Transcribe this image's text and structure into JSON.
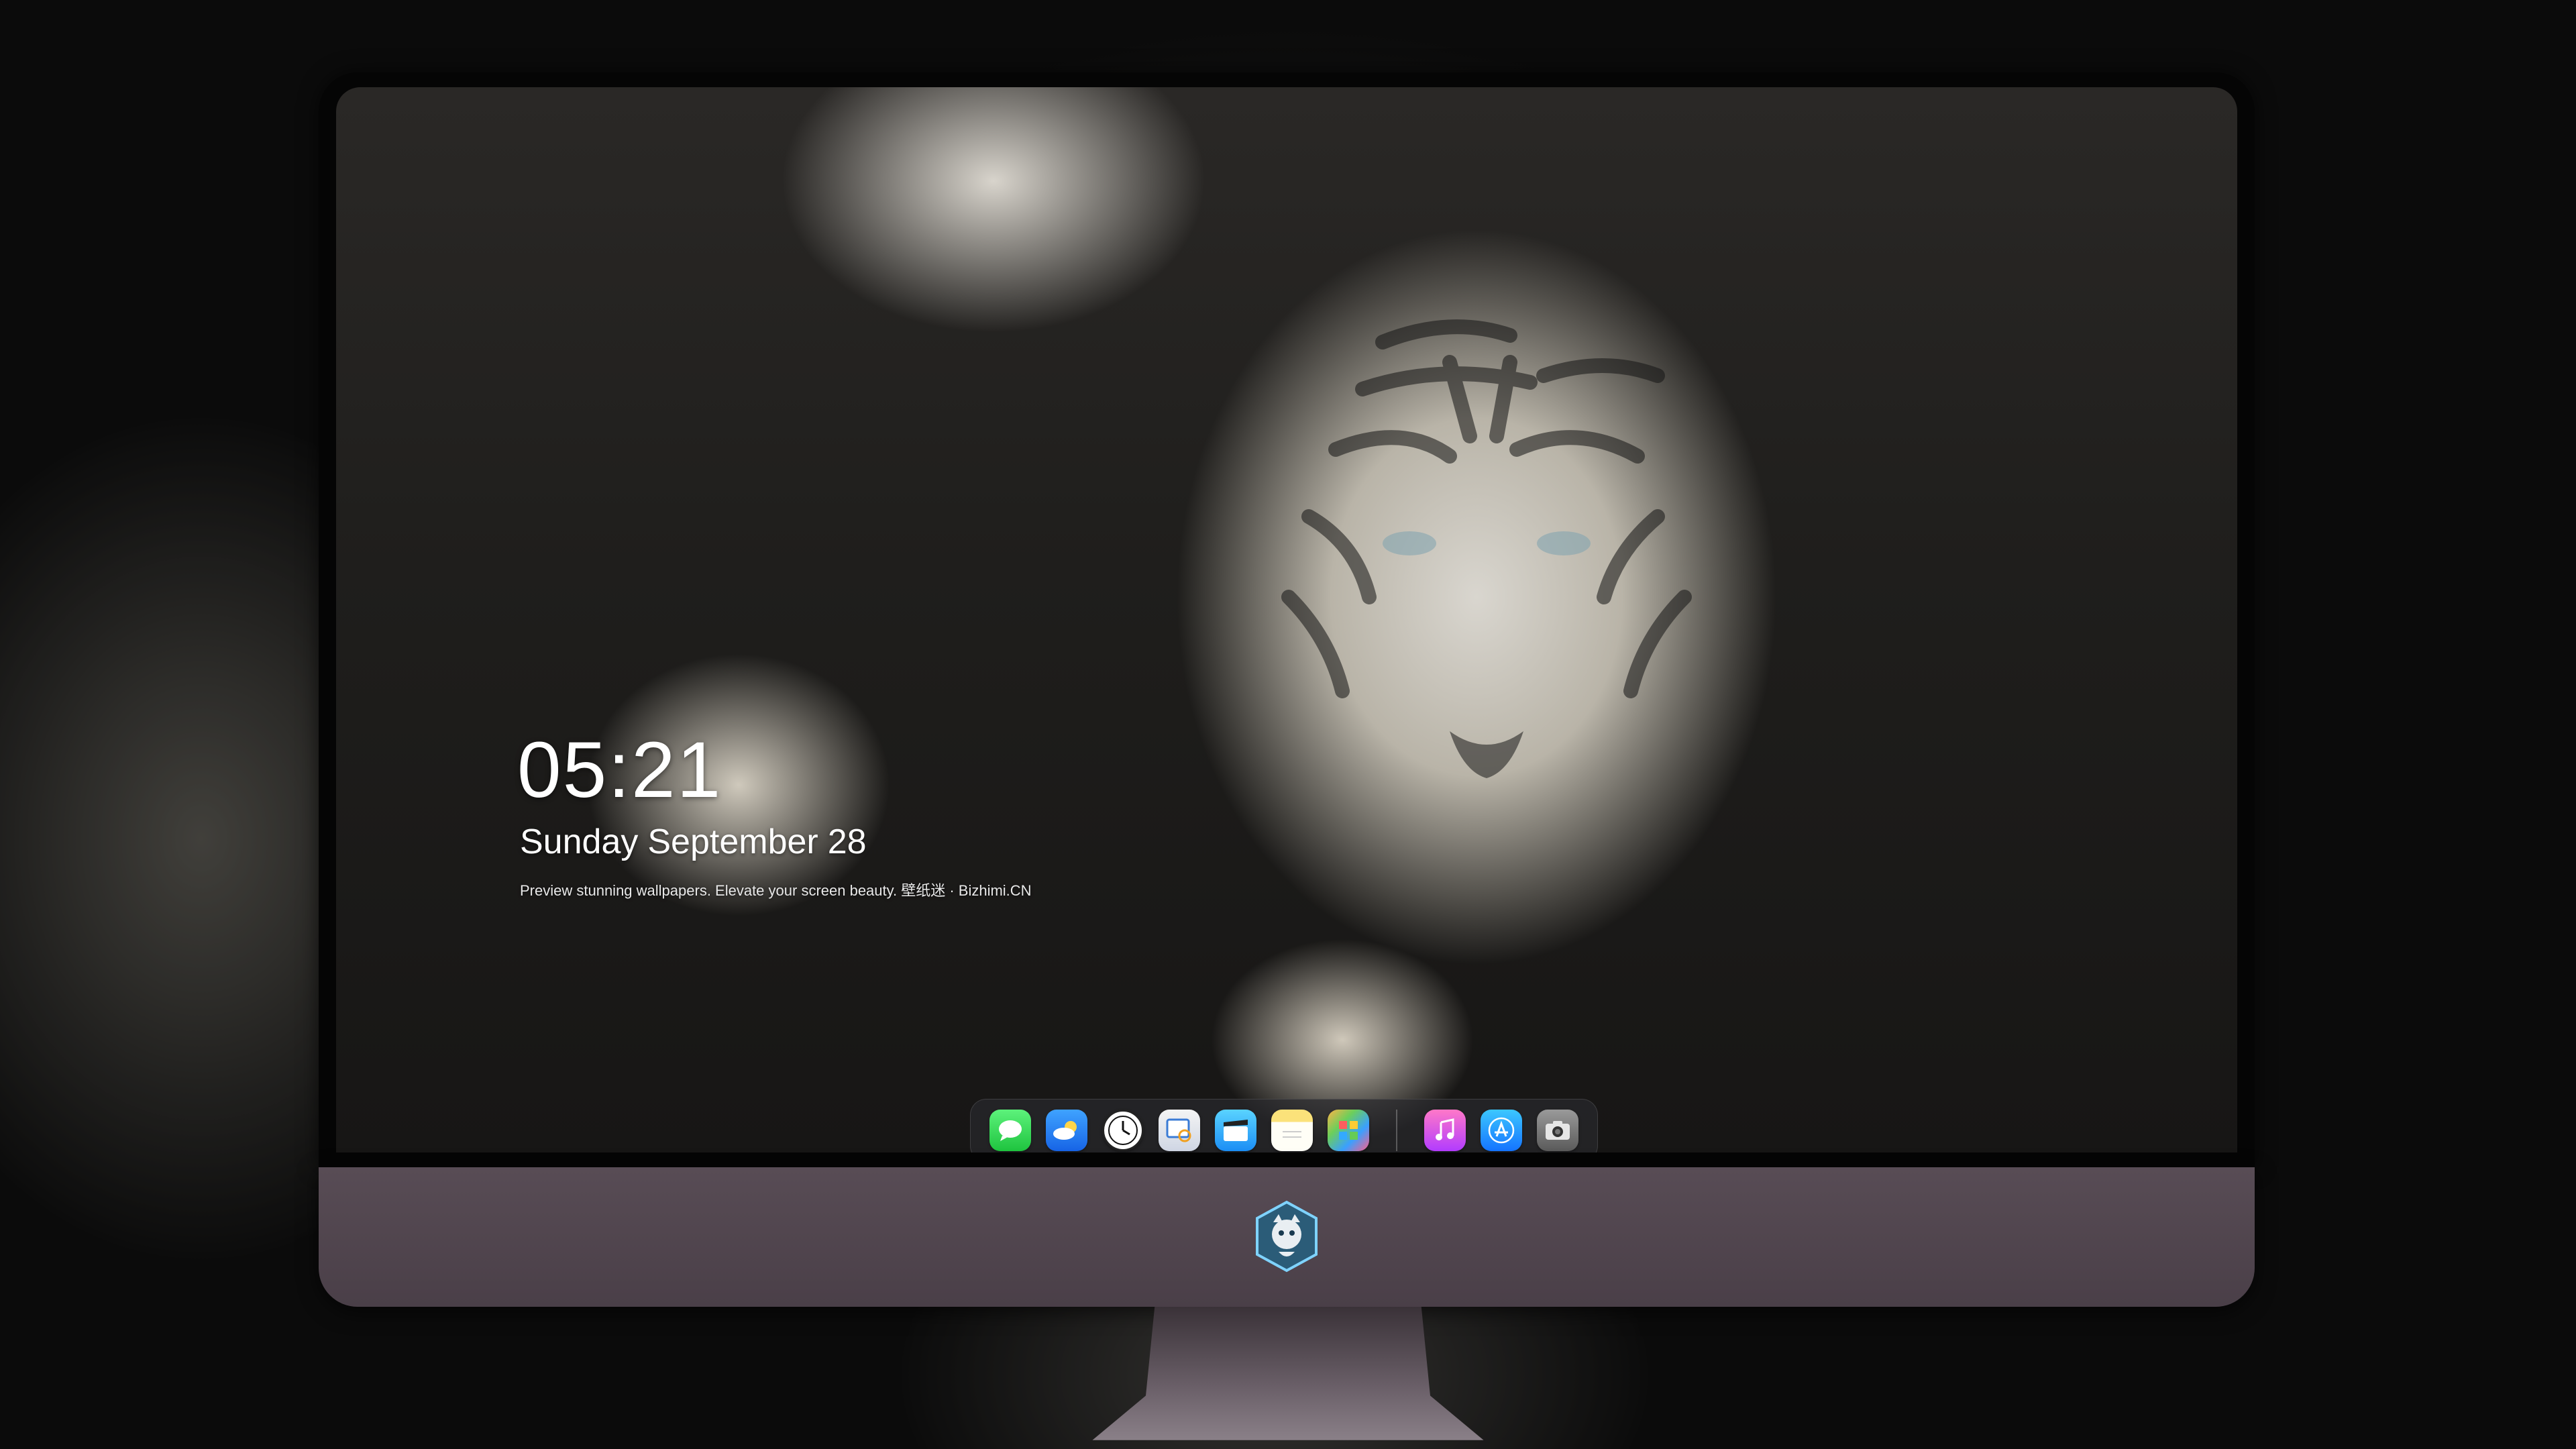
{
  "lock_screen": {
    "time": "05:21",
    "weekday": "Sunday",
    "month": "September",
    "day": "28",
    "tagline": "Preview stunning wallpapers. Elevate your screen beauty. 壁纸迷 · Bizhimi.CN"
  },
  "wallpaper": {
    "subject": "white tiger lying on dark rock"
  },
  "dock": {
    "apps": [
      {
        "name": "Messages",
        "icon": "message-bubble-icon"
      },
      {
        "name": "Weather",
        "icon": "weather-cloud-icon"
      },
      {
        "name": "Clock",
        "icon": "clock-icon"
      },
      {
        "name": "Preview",
        "icon": "preview-icon"
      },
      {
        "name": "Clips",
        "icon": "clapperboard-icon"
      },
      {
        "name": "Notes",
        "icon": "notes-icon"
      },
      {
        "name": "Photos",
        "icon": "photos-icon"
      },
      {
        "name": "Music",
        "icon": "music-note-icon"
      },
      {
        "name": "App Store",
        "icon": "app-store-icon"
      },
      {
        "name": "Camera",
        "icon": "camera-icon"
      }
    ]
  },
  "colors": {
    "chin": "#584c55",
    "dock_bg": "#28282c",
    "text": "#ffffff"
  }
}
